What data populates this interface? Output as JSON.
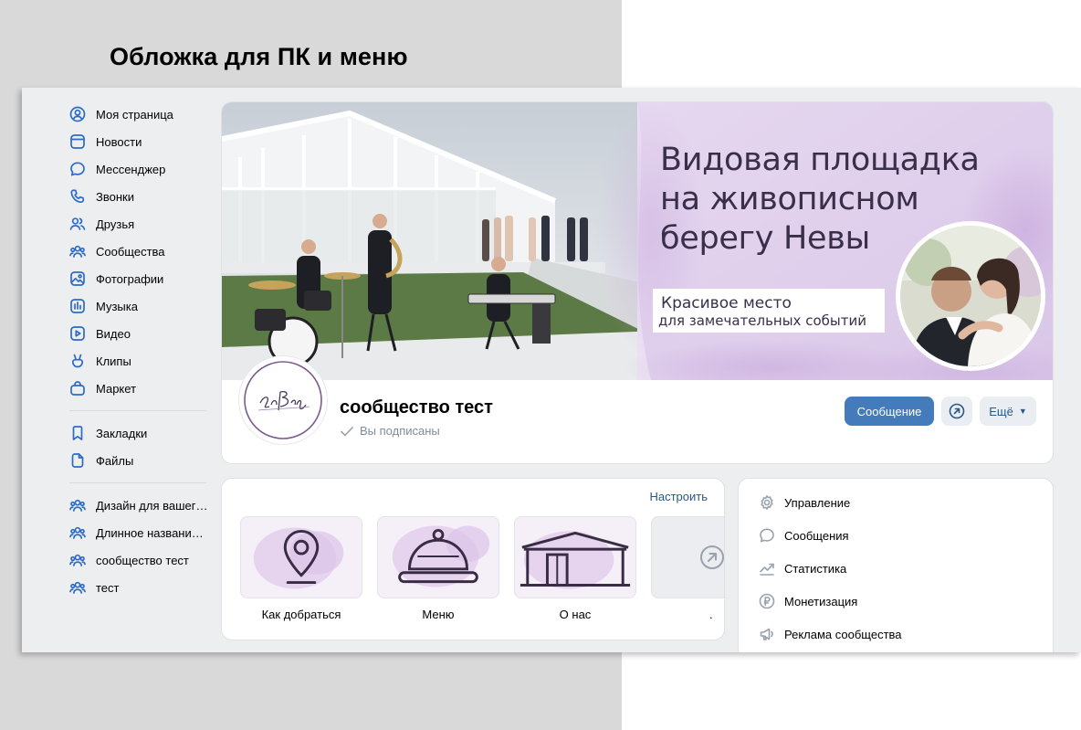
{
  "heading": "Обложка для ПК и меню",
  "sidebar": {
    "items": [
      {
        "label": "Моя страница",
        "icon": "user-circle-icon"
      },
      {
        "label": "Новости",
        "icon": "newspaper-icon"
      },
      {
        "label": "Мессенджер",
        "icon": "chat-bubble-icon"
      },
      {
        "label": "Звонки",
        "icon": "phone-icon"
      },
      {
        "label": "Друзья",
        "icon": "friends-icon"
      },
      {
        "label": "Сообщества",
        "icon": "communities-icon"
      },
      {
        "label": "Фотографии",
        "icon": "photo-icon"
      },
      {
        "label": "Музыка",
        "icon": "music-icon"
      },
      {
        "label": "Видео",
        "icon": "video-icon"
      },
      {
        "label": "Клипы",
        "icon": "clips-icon"
      },
      {
        "label": "Маркет",
        "icon": "market-bag-icon"
      }
    ],
    "items2": [
      {
        "label": "Закладки",
        "icon": "bookmark-icon"
      },
      {
        "label": "Файлы",
        "icon": "file-icon"
      }
    ],
    "groups": [
      {
        "label": "Дизайн для вашег…",
        "icon": "communities-icon"
      },
      {
        "label": "Длинное названи…",
        "icon": "communities-icon"
      },
      {
        "label": "сообщество тест",
        "icon": "communities-icon"
      },
      {
        "label": "тест",
        "icon": "communities-icon"
      }
    ]
  },
  "cover": {
    "title_line1": "Видовая площадка",
    "title_line2": "на живописном",
    "title_line3": "берегу Невы",
    "subtitle_line1": "Красивое место",
    "subtitle_line2": "для замечательных событий"
  },
  "group": {
    "name": "сообщество тест",
    "subscribed": "Вы подписаны",
    "message_button": "Сообщение",
    "more_button": "Ещё"
  },
  "menu": {
    "configure": "Настроить",
    "items": [
      {
        "label": "Как добраться",
        "icon": "location-pin-icon"
      },
      {
        "label": "Меню",
        "icon": "cloche-icon"
      },
      {
        "label": "О нас",
        "icon": "building-icon"
      },
      {
        "label": ".",
        "icon": "arrow-link-icon"
      }
    ]
  },
  "admin": {
    "items": [
      {
        "label": "Управление",
        "icon": "gear-icon"
      },
      {
        "label": "Сообщения",
        "icon": "chat-bubble-icon"
      },
      {
        "label": "Статистика",
        "icon": "stats-icon"
      },
      {
        "label": "Монетизация",
        "icon": "ruble-icon"
      },
      {
        "label": "Реклама сообщества",
        "icon": "megaphone-icon"
      }
    ]
  },
  "colors": {
    "accent": "#447bba",
    "sidebar_icon": "#2d6bc5",
    "cover_lilac": "#e3d3ee",
    "link": "#2a5885"
  }
}
